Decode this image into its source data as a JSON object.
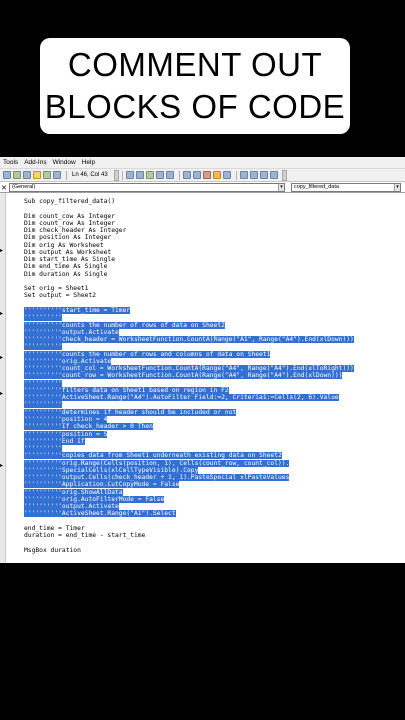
{
  "caption": {
    "lines": [
      "COMMENT OUT",
      "BLOCKS OF CODE"
    ]
  },
  "menu": [
    "Tools",
    "Add-Ins",
    "Window",
    "Help"
  ],
  "toolbar": {
    "position": "Ln 46, Col 43"
  },
  "object_combo": "(General)",
  "procedure_combo": "copy_filtered_data",
  "code_lines": [
    "Sub copy_filtered_data()",
    "",
    "Dim count_cow As Integer",
    "Dim count_row As Integer",
    "Dim check_header As Integer",
    "Dim position As Integer",
    "Dim orig As Worksheet",
    "Dim output As Worksheet",
    "Dim start_time As Single",
    "Dim end_time As Single",
    "Dim duration As Single",
    "",
    "Set orig = Sheet1",
    "Set output = Sheet2",
    "",
    "''''''''''start_time = Timer",
    "''''''''''",
    "''''''''''counts the number of rows of data on Sheet2",
    "''''''''''output.Activate",
    "''''''''''check_header = WorksheetFunction.CountA(Range(\"A1\", Range(\"A4\").End(xlDown)))",
    "''''''''''",
    "''''''''''counts the number of rows and columns of data on Sheet1",
    "''''''''''orig.Activate",
    "''''''''''count_col = WorksheetFunction.CountA(Range(\"A4\", Range(\"A4\").End(xlToRight)))",
    "''''''''''count_row = WorksheetFunction.CountA(Range(\"A4\", Range(\"A4\").End(xlDown)))",
    "''''''''''",
    "''''''''''filters data on Sheet1 based on region in F2",
    "''''''''''ActiveSheet.Range(\"A4\").AutoFilter Field:=2, Criteria1:=Cells(2, 6).Value",
    "''''''''''",
    "''''''''''determines if header should be included or not",
    "''''''''''position = 4",
    "''''''''''If check_header > 0 Then",
    "''''''''''position = 5",
    "''''''''''End If",
    "''''''''''",
    "''''''''''copies data from Sheet1 underneath existing data on Sheet2",
    "''''''''''orig.Range(Cells(position, 1), Cells(count_row, count_col)).",
    "''''''''''SpecialCells(xlCellTypeVisible).Copy",
    "''''''''''output.Cells(check_header + 1, 1).PasteSpecial xlPasteValues",
    "''''''''''Application.CutCopyMode = False",
    "''''''''''orig.ShowAllData",
    "''''''''''orig.AutoFilterMode = False",
    "''''''''''output.Activate",
    "''''''''''ActiveSheet.Range(\"A1\").Select",
    "",
    "end_time = Timer",
    "duration = end_time - start_time",
    "",
    "MsgBox duration"
  ]
}
